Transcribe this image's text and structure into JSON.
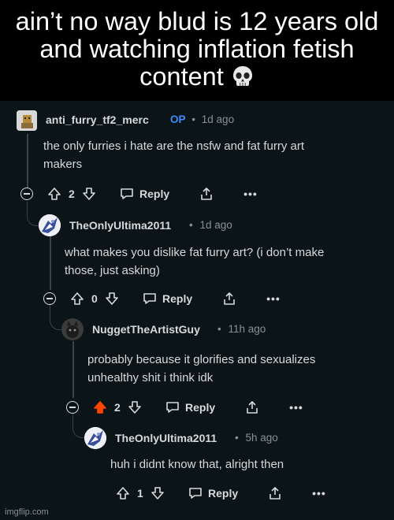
{
  "meme": {
    "caption": "ain’t no way blud is 12 years old and watching inflation fetish content",
    "caption_emoji": "skull-emoji"
  },
  "comments": [
    {
      "username": "anti_furry_tf2_merc",
      "op_badge": "OP",
      "separator": "•",
      "time": "1d ago",
      "body_lines": [
        "the only furries i hate are the nsfw and fat furry art",
        "makers"
      ],
      "votes": "2",
      "reply_label": "Reply"
    },
    {
      "username": "TheOnlyUltima2011",
      "separator": "•",
      "time": "1d ago",
      "body_lines": [
        "what makes you dislike fat furry art? (i don’t make",
        "those, just asking)"
      ],
      "votes": "0",
      "reply_label": "Reply"
    },
    {
      "username": "NuggetTheArtistGuy",
      "separator": "•",
      "time": "11h ago",
      "body_lines": [
        "probably because it glorifies and sexualizes",
        "unhealthy shit i think idk"
      ],
      "votes": "2",
      "upvoted": true,
      "reply_label": "Reply"
    },
    {
      "username": "TheOnlyUltima2011",
      "separator": "•",
      "time": "5h ago",
      "body_lines": [
        "huh i didnt know that, alright then"
      ],
      "votes": "1",
      "reply_label": "Reply"
    }
  ],
  "more_label": "•••",
  "watermark": "imgflip.com",
  "colors": {
    "background": "#0b1416",
    "text": "#d7dadc",
    "meta": "#8a9195",
    "op": "#3e8bff",
    "upvote_active": "#ff4500"
  }
}
